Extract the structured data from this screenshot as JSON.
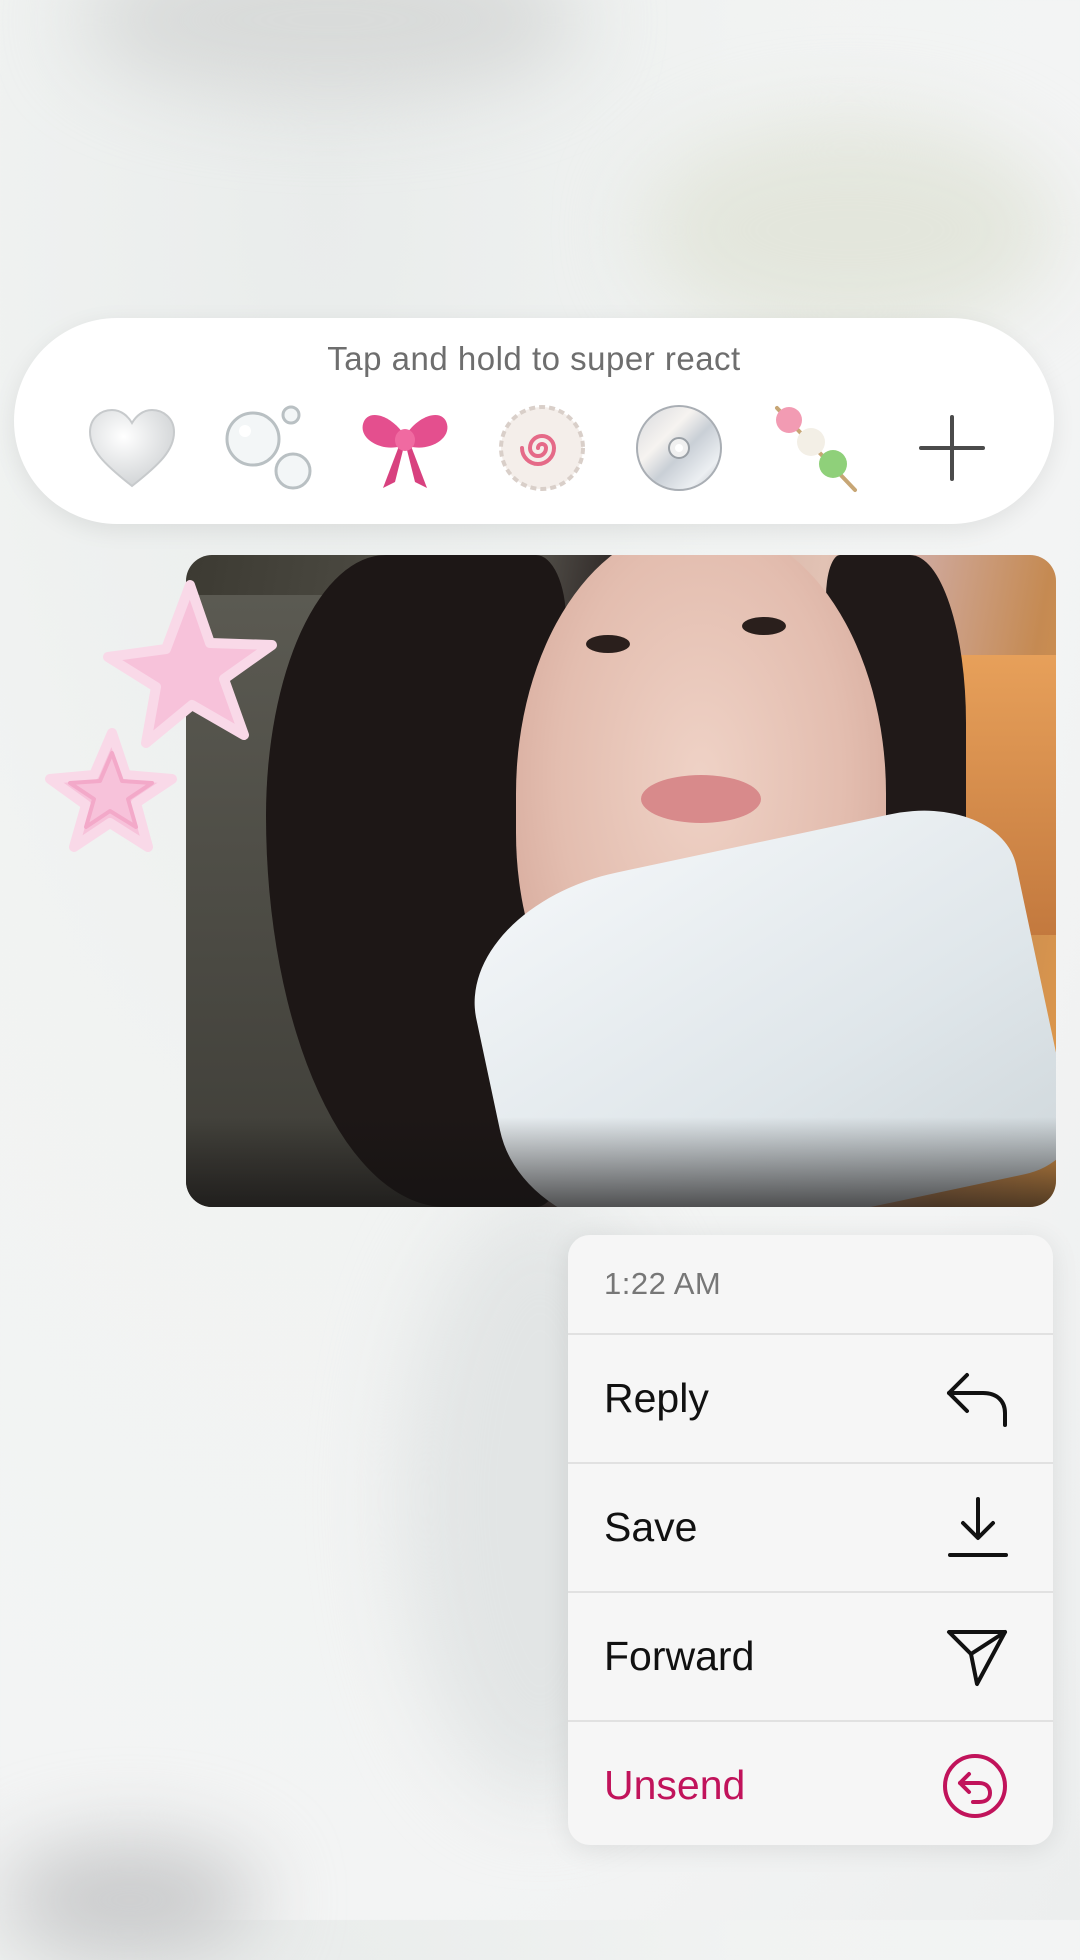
{
  "reactions": {
    "hint": "Tap and hold to super react",
    "items": [
      {
        "name": "white-heart-icon"
      },
      {
        "name": "bubbles-icon"
      },
      {
        "name": "pink-bow-icon"
      },
      {
        "name": "narutomaki-icon"
      },
      {
        "name": "disc-icon"
      },
      {
        "name": "dango-icon"
      },
      {
        "name": "add-reaction-icon"
      }
    ]
  },
  "message": {
    "type": "photo",
    "sticker": "pink-stars"
  },
  "menu": {
    "time": "1:22 AM",
    "items": [
      {
        "label": "Reply",
        "icon": "reply-arrow-icon"
      },
      {
        "label": "Save",
        "icon": "download-icon"
      },
      {
        "label": "Forward",
        "icon": "paper-plane-icon"
      },
      {
        "label": "Unsend",
        "icon": "unsend-circle-icon",
        "color": "#c1135b"
      }
    ]
  },
  "colors": {
    "unsend": "#c1135b",
    "background": "#f1f3f2"
  }
}
